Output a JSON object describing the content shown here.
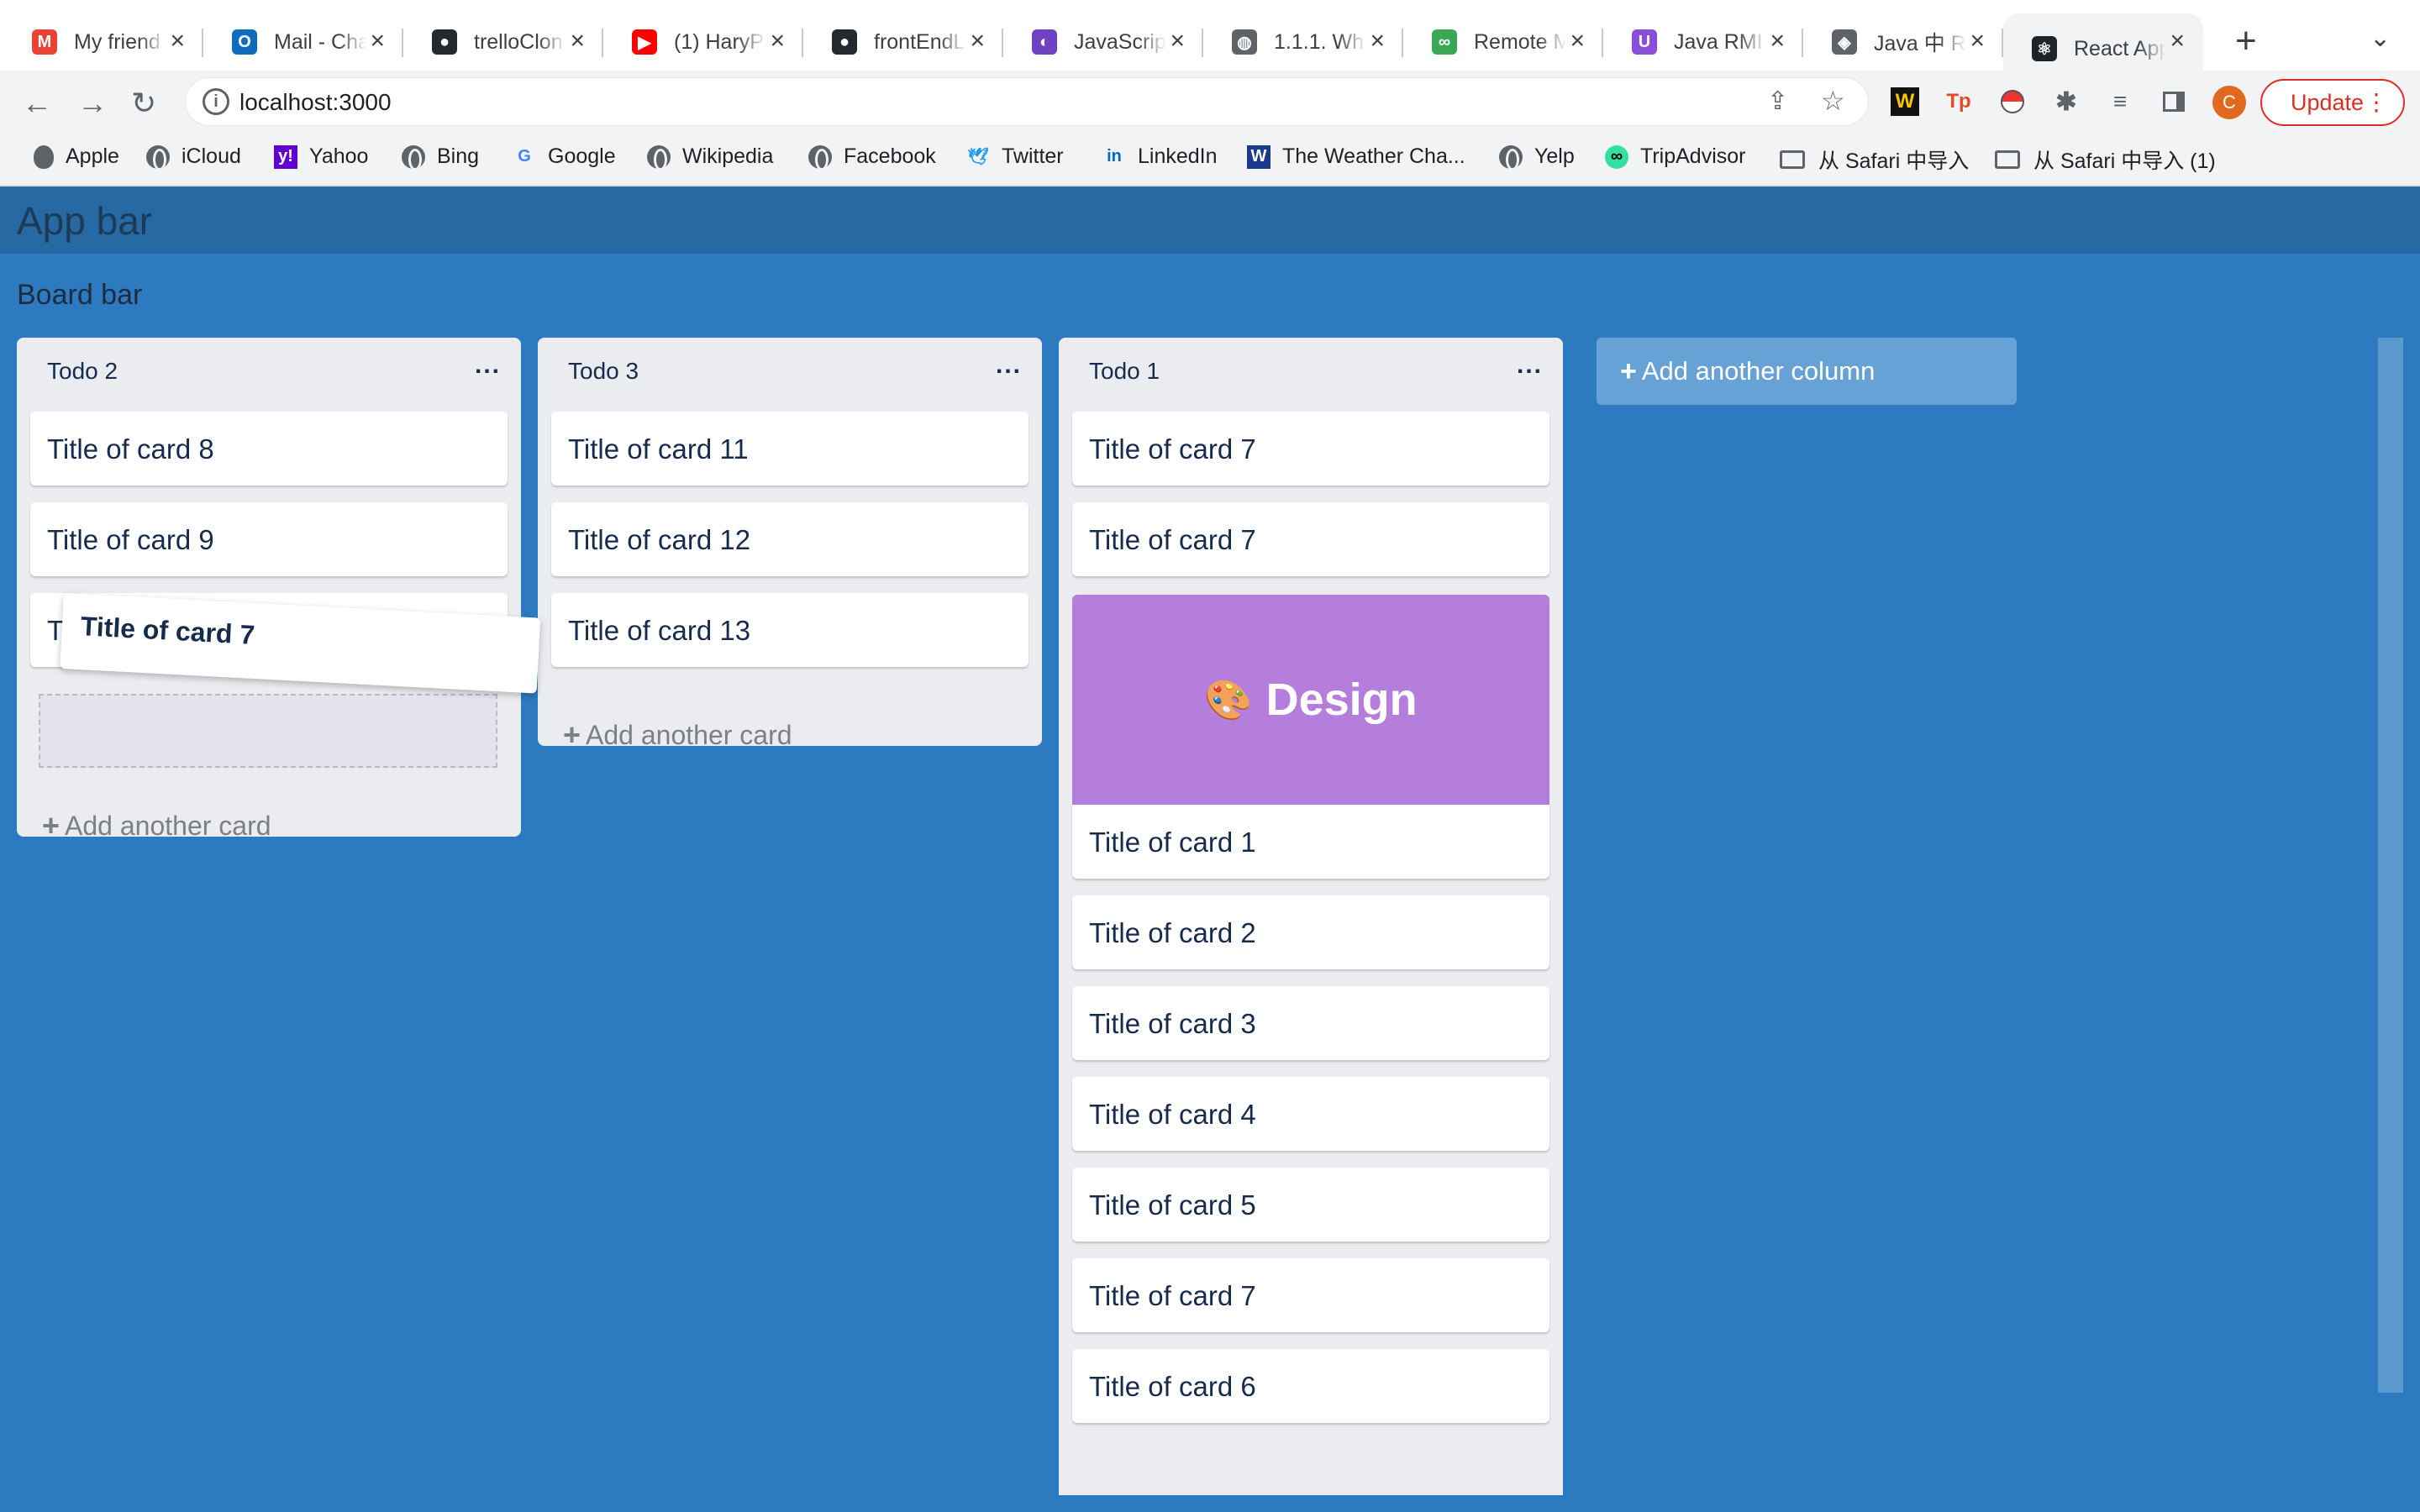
{
  "browser": {
    "tabs": [
      {
        "label": "My friend",
        "icon": "gmail-icon",
        "icon_color": "#ea4335",
        "icon_char": "M"
      },
      {
        "label": "Mail - Cha",
        "icon": "outlook-icon",
        "icon_color": "#0f6cbd",
        "icon_char": "O"
      },
      {
        "label": "trelloClon",
        "icon": "github-icon",
        "icon_color": "#24292f",
        "icon_char": "●"
      },
      {
        "label": "(1) HaryPl",
        "icon": "youtube-icon",
        "icon_color": "#ff0000",
        "icon_char": "▶"
      },
      {
        "label": "frontEndL",
        "icon": "github-icon",
        "icon_color": "#24292f",
        "icon_char": "●"
      },
      {
        "label": "JavaScrip",
        "icon": "javascript-info-icon",
        "icon_color": "#6e42c1",
        "icon_char": "◐"
      },
      {
        "label": "1.1.1. Wha",
        "icon": "globe-icon",
        "icon_color": "#5f6368",
        "icon_char": "◍"
      },
      {
        "label": "Remote M",
        "icon": "remote-icon",
        "icon_color": "#3aa757",
        "icon_char": "∞"
      },
      {
        "label": "Java RMI",
        "icon": "java-rmi-icon",
        "icon_color": "#8a4fd8",
        "icon_char": "U"
      },
      {
        "label": "Java 中 RI",
        "icon": "layers-icon",
        "icon_color": "#5f6368",
        "icon_char": "◈"
      },
      {
        "label": "React App",
        "icon": "react-icon",
        "icon_color": "#20232a",
        "icon_char": "⚛",
        "active": true
      }
    ],
    "url": "localhost:3000",
    "update_label": "Update",
    "profile_initial": "C",
    "bookmarks": [
      {
        "label": "Apple",
        "icon": "apple-icon"
      },
      {
        "label": "iCloud",
        "icon": "globe-icon"
      },
      {
        "label": "Yahoo",
        "icon": "yahoo-icon"
      },
      {
        "label": "Bing",
        "icon": "globe-icon"
      },
      {
        "label": "Google",
        "icon": "google-icon"
      },
      {
        "label": "Wikipedia",
        "icon": "globe-icon"
      },
      {
        "label": "Facebook",
        "icon": "globe-icon"
      },
      {
        "label": "Twitter",
        "icon": "twitter-icon"
      },
      {
        "label": "LinkedIn",
        "icon": "linkedin-icon"
      },
      {
        "label": "The Weather Cha...",
        "icon": "weather-channel-icon"
      },
      {
        "label": "Yelp",
        "icon": "globe-icon"
      },
      {
        "label": "TripAdvisor",
        "icon": "tripadvisor-icon"
      },
      {
        "label": "从 Safari 中导入",
        "icon": "folder-icon"
      },
      {
        "label": "从 Safari 中导入 (1)",
        "icon": "folder-icon"
      }
    ]
  },
  "app": {
    "app_bar_title": "App bar",
    "board_bar_title": "Board bar",
    "columns": [
      {
        "title": "Todo 2",
        "menu": "...",
        "cards": [
          "Title of card 8",
          "Title of card 9",
          "Ti"
        ],
        "add_card_label": "Add another card"
      },
      {
        "title": "Todo 3",
        "menu": "...",
        "cards": [
          "Title of card 11",
          "Title of card 12",
          "Title of card 13"
        ],
        "add_card_label": "Add another card"
      },
      {
        "title": "Todo 1",
        "menu": "...",
        "cards": [
          "Title of card 7",
          "Title of card 7",
          "Title of card 1",
          "Title of card 2",
          "Title of card 3",
          "Title of card 4",
          "Title of card 5",
          "Title of card 7",
          "Title of card 6"
        ],
        "cover_image_text": "Design",
        "cover_image_emoji": "🎨"
      }
    ],
    "dragging_card": "Title of card 7",
    "add_column_label": "Add another column",
    "colors": {
      "board": "#2e7ac0",
      "app_bar": "#2769a3",
      "column": "#ebecf0",
      "cover": "#b57ddc",
      "add_column": "#66a2d6"
    }
  }
}
